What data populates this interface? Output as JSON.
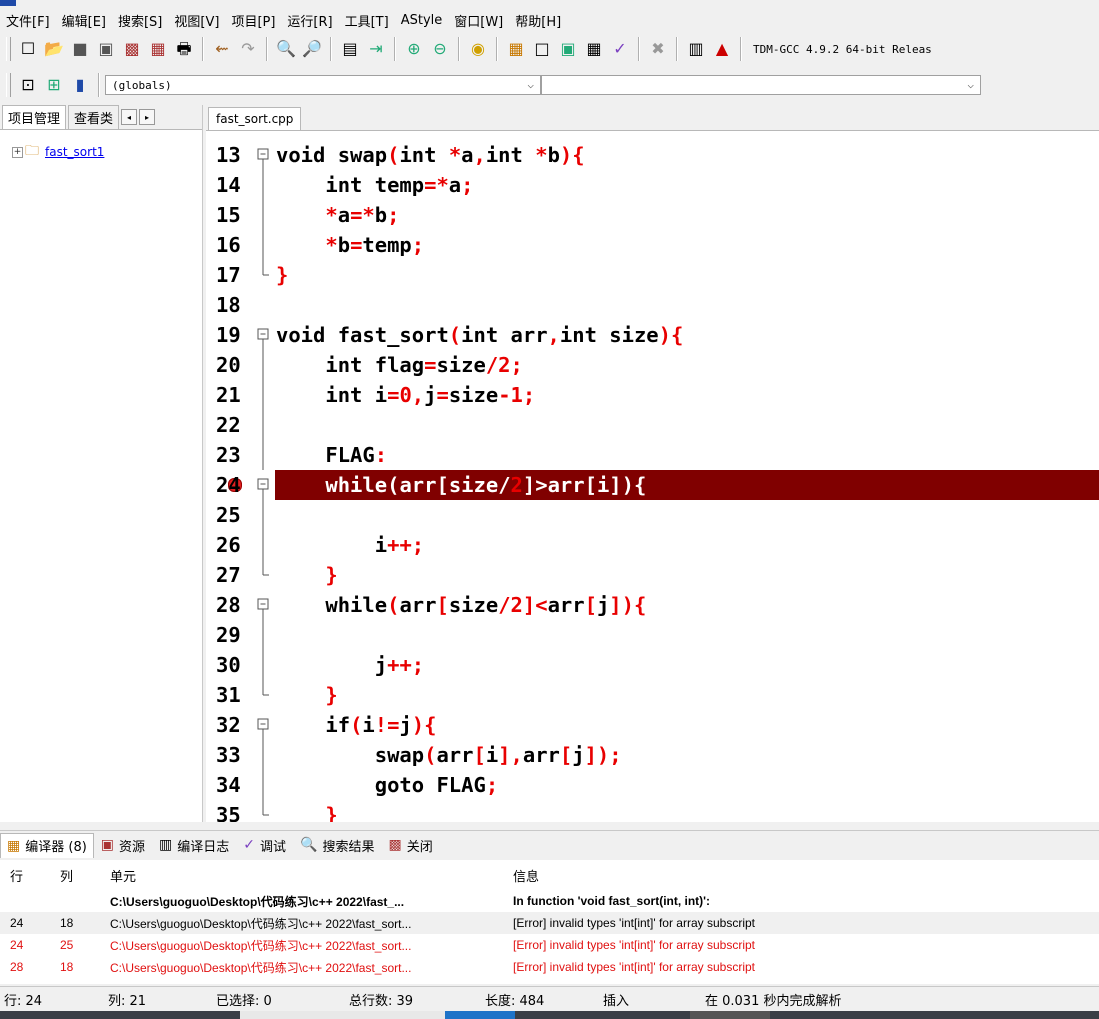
{
  "menu": [
    "文件[F]",
    "编辑[E]",
    "搜索[S]",
    "视图[V]",
    "项目[P]",
    "运行[R]",
    "工具[T]",
    "AStyle",
    "窗口[W]",
    "帮助[H]"
  ],
  "toolbar": {
    "compiler_select": "TDM-GCC 4.9.2 64-bit Releas",
    "globals_select": "(globals)",
    "func_select": ""
  },
  "left_panel": {
    "tabs": [
      "项目管理",
      "查看类"
    ],
    "project_name": "fast_sort1"
  },
  "editor": {
    "file_tab": "fast_sort.cpp",
    "lines": [
      {
        "n": "13",
        "fold": "start",
        "code": "void swap(int *a,int *b){"
      },
      {
        "n": "14",
        "fold": "mid",
        "code": "    int temp=*a;"
      },
      {
        "n": "15",
        "fold": "mid",
        "code": "    *a=*b;"
      },
      {
        "n": "16",
        "fold": "mid",
        "code": "    *b=temp;"
      },
      {
        "n": "17",
        "fold": "end",
        "code": "}"
      },
      {
        "n": "18",
        "fold": "",
        "code": ""
      },
      {
        "n": "19",
        "fold": "start",
        "code": "void fast_sort(int arr,int size){"
      },
      {
        "n": "20",
        "fold": "mid",
        "code": "    int flag=size/2;"
      },
      {
        "n": "21",
        "fold": "mid",
        "code": "    int i=0,j=size-1;"
      },
      {
        "n": "22",
        "fold": "mid",
        "code": ""
      },
      {
        "n": "23",
        "fold": "mid",
        "code": "    FLAG:"
      },
      {
        "n": "24",
        "fold": "start2",
        "code": "    while(arr[size/2]>arr[i]){",
        "highlight": true
      },
      {
        "n": "25",
        "fold": "mid2",
        "code": ""
      },
      {
        "n": "26",
        "fold": "mid2",
        "code": "        i++;"
      },
      {
        "n": "27",
        "fold": "end2",
        "code": "    }"
      },
      {
        "n": "28",
        "fold": "start2",
        "code": "    while(arr[size/2]<arr[j]){"
      },
      {
        "n": "29",
        "fold": "mid2",
        "code": ""
      },
      {
        "n": "30",
        "fold": "mid2",
        "code": "        j++;"
      },
      {
        "n": "31",
        "fold": "end2",
        "code": "    }"
      },
      {
        "n": "32",
        "fold": "start2",
        "code": "    if(i!=j){"
      },
      {
        "n": "33",
        "fold": "mid2",
        "code": "        swap(arr[i],arr[j]);"
      },
      {
        "n": "34",
        "fold": "mid2",
        "code": "        goto FLAG;"
      },
      {
        "n": "35",
        "fold": "end2",
        "code": "    }"
      }
    ]
  },
  "bottom_tabs": [
    {
      "icon": "compiler-icon",
      "label": "编译器 (8)"
    },
    {
      "icon": "resources-icon",
      "label": "资源"
    },
    {
      "icon": "compile-log-icon",
      "label": "编译日志"
    },
    {
      "icon": "debug-icon",
      "label": "调试"
    },
    {
      "icon": "search-results-icon",
      "label": "搜索结果"
    },
    {
      "icon": "close-icon",
      "label": "关闭"
    }
  ],
  "log": {
    "headers": [
      "行",
      "列",
      "单元",
      "信息"
    ],
    "rows": [
      {
        "line": "",
        "col": "",
        "unit": "C:\\Users\\guoguo\\Desktop\\代码练习\\c++ 2022\\fast_...",
        "msg": "In function 'void fast_sort(int, int)':",
        "kind": "bold"
      },
      {
        "line": "24",
        "col": "18",
        "unit": "C:\\Users\\guoguo\\Desktop\\代码练习\\c++ 2022\\fast_sort...",
        "msg": "[Error] invalid types 'int[int]' for array subscript",
        "kind": "first"
      },
      {
        "line": "24",
        "col": "25",
        "unit": "C:\\Users\\guoguo\\Desktop\\代码练习\\c++ 2022\\fast_sort...",
        "msg": "[Error] invalid types 'int[int]' for array subscript",
        "kind": "err"
      },
      {
        "line": "28",
        "col": "18",
        "unit": "C:\\Users\\guoguo\\Desktop\\代码练习\\c++ 2022\\fast_sort...",
        "msg": "[Error] invalid types 'int[int]' for array subscript",
        "kind": "err"
      }
    ]
  },
  "status": {
    "row": "行: 24",
    "col": "列: 21",
    "selected": "已选择: 0",
    "total": "总行数: 39",
    "length": "长度: 484",
    "mode": "插入",
    "parse": "在 0.031 秒内完成解析"
  }
}
